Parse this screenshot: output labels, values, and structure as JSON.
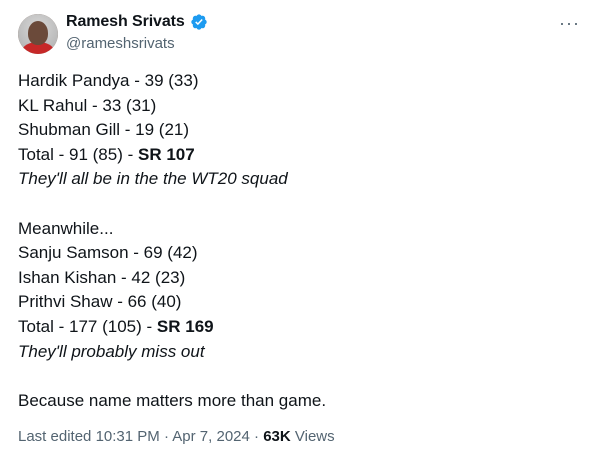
{
  "author": {
    "display_name": "Ramesh Srivats",
    "handle": "@rameshsrivats",
    "verified_color": "#1d9bf0"
  },
  "more_label": "···",
  "tweet": {
    "group1": [
      "Hardik Pandya - 39 (33)",
      "KL Rahul - 33 (31)",
      "Shubman Gill - 19 (21)"
    ],
    "total1_prefix": "Total - 91 (85) - ",
    "total1_sr": "SR 107",
    "note1": "They'll all be in the the WT20 squad",
    "meanwhile": "Meanwhile...",
    "group2": [
      "Sanju Samson - 69 (42)",
      "Ishan Kishan - 42 (23)",
      "Prithvi Shaw - 66 (40)"
    ],
    "total2_prefix": "Total - 177 (105) - ",
    "total2_sr": "SR 169",
    "note2": "They'll probably miss out",
    "closing": "Because name matters more than game."
  },
  "meta": {
    "edited_prefix": "Last edited ",
    "time": "10:31 PM",
    "sep1": " · ",
    "date": "Apr 7, 2024",
    "sep2": " · ",
    "views_count": "63K",
    "views_label": " Views"
  }
}
